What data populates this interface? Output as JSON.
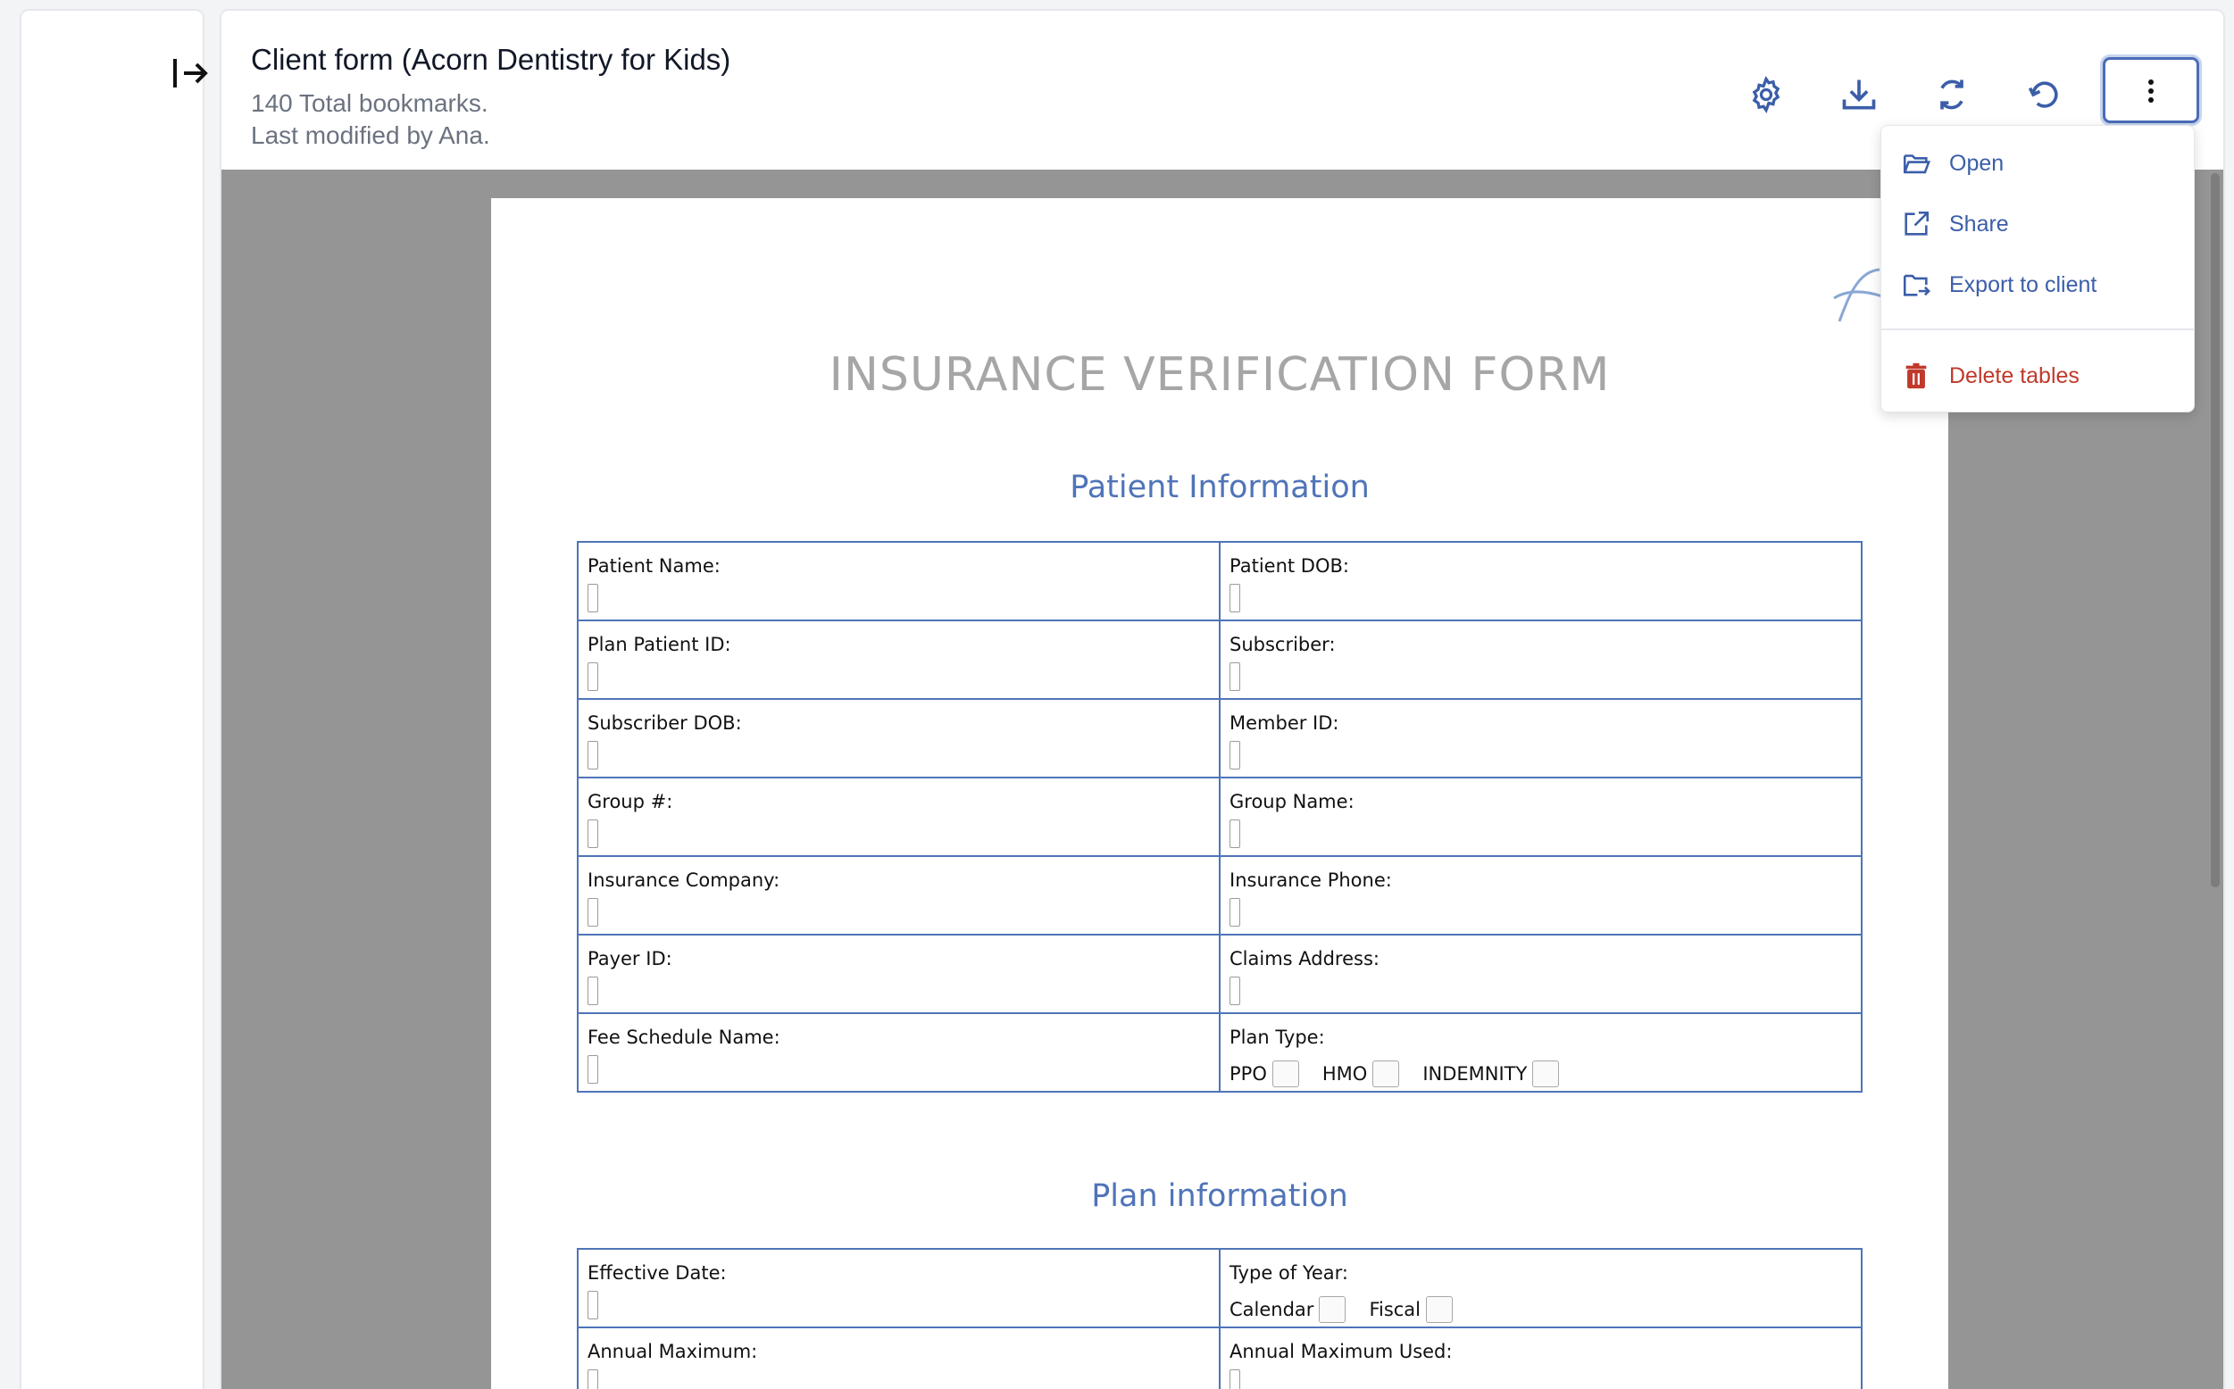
{
  "header": {
    "title": "Client form (Acorn Dentistry for Kids)",
    "bookmarks": "140 Total bookmarks.",
    "modified": "Last modified by Ana."
  },
  "toolbar": {
    "icons": [
      "gear-icon",
      "download-icon",
      "sync-icon",
      "undo-icon",
      "more-vertical-icon"
    ]
  },
  "menu": {
    "items": [
      {
        "label": "Open",
        "icon": "folder-open-icon"
      },
      {
        "label": "Share",
        "icon": "external-link-icon"
      },
      {
        "label": "Export to client",
        "icon": "folder-export-icon"
      },
      {
        "label": "Delete tables",
        "icon": "trash-icon",
        "color": "#c0392b"
      }
    ]
  },
  "form": {
    "title": "INSURANCE VERIFICATION FORM",
    "patient_section": {
      "title": "Patient Information",
      "rows": [
        [
          "Patient Name:",
          "Patient DOB:"
        ],
        [
          "Plan Patient ID:",
          "Subscriber:"
        ],
        [
          "Subscriber DOB:",
          "Member ID:"
        ],
        [
          "Group #:",
          "Group Name:"
        ],
        [
          "Insurance Company:",
          "Insurance Phone:"
        ],
        [
          "Payer ID:",
          "Claims Address:"
        ],
        [
          "Fee Schedule Name:",
          "Plan Type:"
        ]
      ],
      "plan_type_options": [
        "PPO",
        "HMO",
        "INDEMNITY"
      ]
    },
    "plan_section": {
      "title": "Plan information",
      "rows": [
        [
          "Effective Date:",
          "Type of Year:"
        ],
        [
          "Annual Maximum:",
          "Annual Maximum Used:"
        ]
      ],
      "year_type_options": [
        "Calendar",
        "Fiscal"
      ]
    }
  },
  "colors": {
    "accent": "#4f74b8",
    "menu_text": "#3b5ea8",
    "danger": "#c0392b",
    "viewer_bg": "#959595"
  }
}
